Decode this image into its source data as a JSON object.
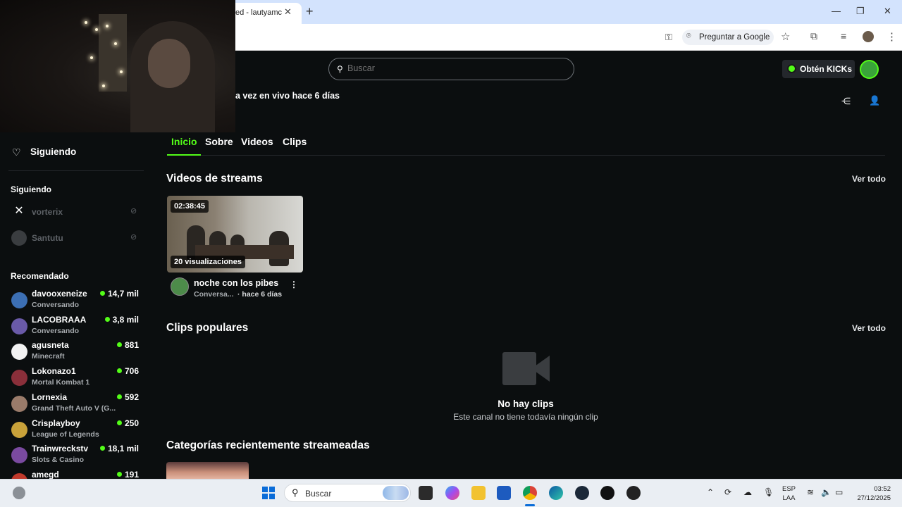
{
  "browser": {
    "tab_title": "ed - lautyamc",
    "tab_close": "✕",
    "new_tab": "+",
    "ask_google": "Preguntar a Google",
    "window_controls": {
      "minimize": "—",
      "maximize": "❐",
      "close": "✕"
    }
  },
  "header": {
    "search_placeholder": "Buscar",
    "get_kicks": "Obtén KICKs",
    "last_live": "a vez en vivo hace 6 días"
  },
  "sidebar": {
    "following_button": "Siguiendo",
    "following_heading": "Siguiendo",
    "following": [
      {
        "name": "vorterix"
      },
      {
        "name": "Santutu"
      }
    ],
    "recommended_heading": "Recomendado",
    "recommended": [
      {
        "name": "davooxeneize",
        "category": "Conversando",
        "viewers": "14,7 mil",
        "avatar_color": "#3c6fb4"
      },
      {
        "name": "LACOBRAAA",
        "category": "Conversando",
        "viewers": "3,8 mil",
        "avatar_color": "#6a5aa8"
      },
      {
        "name": "agusneta",
        "category": "Minecraft",
        "viewers": "881",
        "avatar_color": "#f2f2f2"
      },
      {
        "name": "Lokonazo1",
        "category": "Mortal Kombat 1",
        "viewers": "706",
        "avatar_color": "#8a2f3a"
      },
      {
        "name": "Lornexia",
        "category": "Grand Theft Auto V (G...",
        "viewers": "592",
        "avatar_color": "#9a7b6a"
      },
      {
        "name": "Crisplayboy",
        "category": "League of Legends",
        "viewers": "250",
        "avatar_color": "#c9a23a"
      },
      {
        "name": "Trainwreckstv",
        "category": "Slots & Casino",
        "viewers": "18,1 mil",
        "avatar_color": "#7a4aa0"
      },
      {
        "name": "amegd",
        "category": "",
        "viewers": "191",
        "avatar_color": "#c0392b"
      }
    ]
  },
  "tabs": [
    "Inicio",
    "Sobre",
    "Videos",
    "Clips"
  ],
  "sections": {
    "videos_title": "Videos de streams",
    "clips_title": "Clips populares",
    "categories_title": "Categorías recientemente streameadas",
    "see_all": "Ver todo"
  },
  "video": {
    "duration": "02:38:45",
    "views": "20 visualizaciones",
    "title": "noche con los pibes",
    "category": "Conversa...",
    "age": "· hace 6 días"
  },
  "clips_empty": {
    "title": "No hay clips",
    "subtitle": "Este canal no tiene todavía ningún clip"
  },
  "taskbar": {
    "search_label": "Buscar",
    "lang_line1": "ESP",
    "lang_line2": "LAA",
    "time": "03:52",
    "date": "27/12/2025"
  },
  "colors": {
    "accent": "#53fc18",
    "background": "#0b0e0f"
  }
}
